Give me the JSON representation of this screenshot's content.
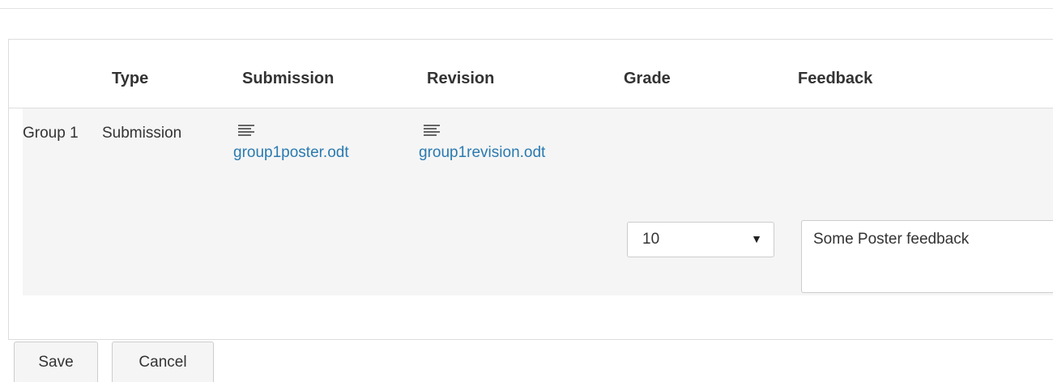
{
  "table": {
    "headers": [
      "",
      "Type",
      "Submission",
      "Revision",
      "Grade",
      "Feedback"
    ],
    "rows": [
      {
        "group": "Group 1",
        "type": "Submission",
        "submission_file": "group1poster.odt",
        "submission_icon": "document-icon",
        "revision_file": "group1revision.odt",
        "revision_icon": "document-icon",
        "grade": "10",
        "feedback": "Some Poster feedback"
      }
    ]
  },
  "actions": {
    "save_label": "Save",
    "cancel_label": "Cancel"
  },
  "colors": {
    "link": "#2a7ab0",
    "row_background": "#f5f5f5",
    "border": "#dddddd"
  }
}
